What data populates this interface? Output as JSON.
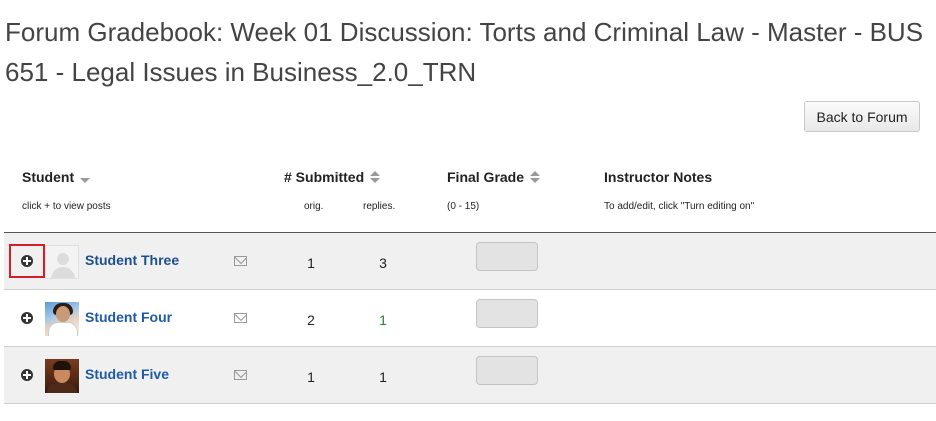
{
  "page": {
    "title": "Forum Gradebook: Week 01 Discussion: Torts and Criminal Law - Master - BUS 651 - Legal Issues in Business_2.0_TRN"
  },
  "toolbar": {
    "back_label": "Back to Forum"
  },
  "table": {
    "headers": {
      "student": "Student",
      "student_sub": "click + to view posts",
      "submitted": "# Submitted",
      "submitted_orig": "orig.",
      "submitted_replies": "replies.",
      "final_grade": "Final Grade",
      "final_grade_sub": "(0 - 15)",
      "notes": "Instructor Notes",
      "notes_sub": "To add/edit, click \"Turn editing on\""
    },
    "rows": [
      {
        "name": "Student Three",
        "orig": "1",
        "replies": "3",
        "grade": "",
        "avatar": "placeholder-avatar",
        "expand_highlighted": true
      },
      {
        "name": "Student Four",
        "orig": "2",
        "replies": "1",
        "grade": "",
        "avatar": "student-photo",
        "expand_highlighted": false
      },
      {
        "name": "Student Five",
        "orig": "1",
        "replies": "1",
        "grade": "",
        "avatar": "student-photo",
        "expand_highlighted": false
      }
    ]
  },
  "colors": {
    "link": "#1f5aa6",
    "highlight": "#d21f2b",
    "reply_count": "#2d7d2d",
    "row_shade": "#f0f0f0"
  }
}
